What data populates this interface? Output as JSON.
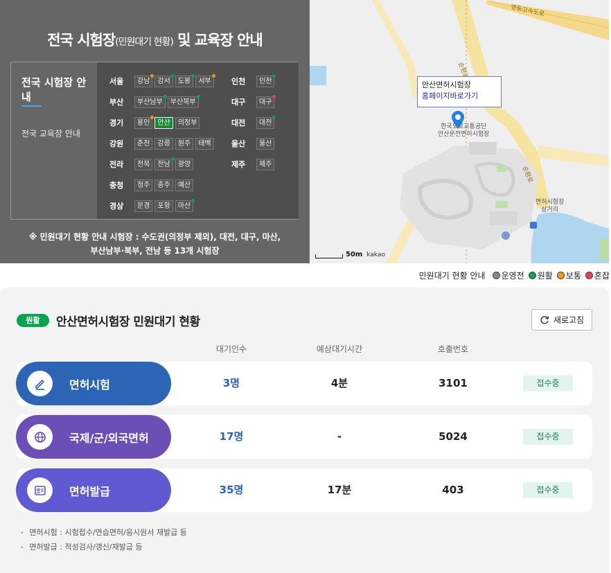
{
  "guide": {
    "title_main": "전국 시험장",
    "title_small": "(민원대기 현황)",
    "title_rest": " 및 교육장 안내",
    "tab_active": "전국 시험장 안내",
    "tab_inactive": "전국 교육장 안내",
    "regions": [
      {
        "label": "서울",
        "items": [
          {
            "name": "강남",
            "status": "normal"
          },
          {
            "name": "강서",
            "status": "smooth"
          },
          {
            "name": "도봉",
            "status": "smooth"
          },
          {
            "name": "서부",
            "status": "normal"
          }
        ]
      },
      {
        "label": "인천",
        "items": [
          {
            "name": "인천",
            "status": "smooth"
          }
        ]
      },
      {
        "label": "부산",
        "items": [
          {
            "name": "부산남부",
            "status": "smooth"
          },
          {
            "name": "부산북부",
            "status": "smooth"
          }
        ]
      },
      {
        "label": "대구",
        "items": [
          {
            "name": "대구",
            "status": "busy"
          }
        ]
      },
      {
        "label": "경기",
        "items": [
          {
            "name": "용인",
            "status": "normal"
          },
          {
            "name": "안산",
            "status": "selected"
          },
          {
            "name": "의정부",
            "status": "none"
          }
        ]
      },
      {
        "label": "대전",
        "items": [
          {
            "name": "대전",
            "status": "smooth"
          }
        ]
      },
      {
        "label": "강원",
        "items": [
          {
            "name": "춘천",
            "status": "none"
          },
          {
            "name": "강릉",
            "status": "none"
          },
          {
            "name": "원주",
            "status": "none"
          },
          {
            "name": "태백",
            "status": "none"
          }
        ]
      },
      {
        "label": "울산",
        "items": [
          {
            "name": "울산",
            "status": "none"
          }
        ]
      },
      {
        "label": "전라",
        "items": [
          {
            "name": "전북",
            "status": "none"
          },
          {
            "name": "전남",
            "status": "smooth"
          },
          {
            "name": "광양",
            "status": "none"
          }
        ]
      },
      {
        "label": "제주",
        "items": [
          {
            "name": "제주",
            "status": "none"
          }
        ]
      },
      {
        "label": "충청",
        "items": [
          {
            "name": "청주",
            "status": "none"
          },
          {
            "name": "충주",
            "status": "none"
          },
          {
            "name": "예산",
            "status": "none"
          }
        ]
      },
      {
        "label": "경상",
        "items": [
          {
            "name": "문경",
            "status": "none"
          },
          {
            "name": "포항",
            "status": "none"
          },
          {
            "name": "마산",
            "status": "smooth"
          }
        ]
      }
    ],
    "note_line1": "※ 민원대기 현황 안내 시험장 : 수도권(의정부 제외), 대전, 대구, 마산,",
    "note_line2": "부산남부·북부, 전남 등 13개 시험장"
  },
  "map": {
    "callout_name": "안산면허시험장",
    "callout_link": "홈페이지바로가기",
    "marker_label_line1": "한국도로교통공단",
    "marker_label_line2": "안산운전면허시험장",
    "road_top": "영동고속도로",
    "road_vertical": "순환로",
    "road_right": "순환로",
    "place_line1": "면허시험장",
    "place_line2": "삼거리",
    "scale": "50m",
    "brand": "kakao"
  },
  "legend": {
    "title": "민원대기 현황 안내",
    "items": [
      {
        "label": "운영전",
        "color": "#888888"
      },
      {
        "label": "원활",
        "color": "#0aa34f"
      },
      {
        "label": "보통",
        "color": "#f29a12"
      },
      {
        "label": "혼잡",
        "color": "#e8424d"
      }
    ]
  },
  "status": {
    "badge": "원활",
    "title": "안산면허시험장 민원대기 현황",
    "refresh": "새로고침",
    "columns": [
      "대기인수",
      "예상대기시간",
      "호출번호"
    ],
    "rows": [
      {
        "label": "면허시험",
        "count": "3명",
        "wait": "4분",
        "call": "3101",
        "state": "접수중",
        "color": "#2c65b5",
        "icon": "pencil-icon"
      },
      {
        "label": "국제/군/외국면허",
        "count": "17명",
        "wait": "-",
        "call": "5024",
        "state": "접수중",
        "color": "#6b4fb6",
        "icon": "globe-icon"
      },
      {
        "label": "면허발급",
        "count": "35명",
        "wait": "17분",
        "call": "403",
        "state": "접수중",
        "color": "#5f5ad1",
        "icon": "id-card-icon"
      }
    ],
    "notes": [
      "면허시험 : 시험접수/연습면허/응시원서 재발급 등",
      "면허발급 : 적성검사/갱신/재발급 등"
    ]
  },
  "colors": {
    "smooth": "#0aa34f",
    "normal": "#f29a12",
    "busy": "#e8424d",
    "accent": "#3fa9f5"
  }
}
